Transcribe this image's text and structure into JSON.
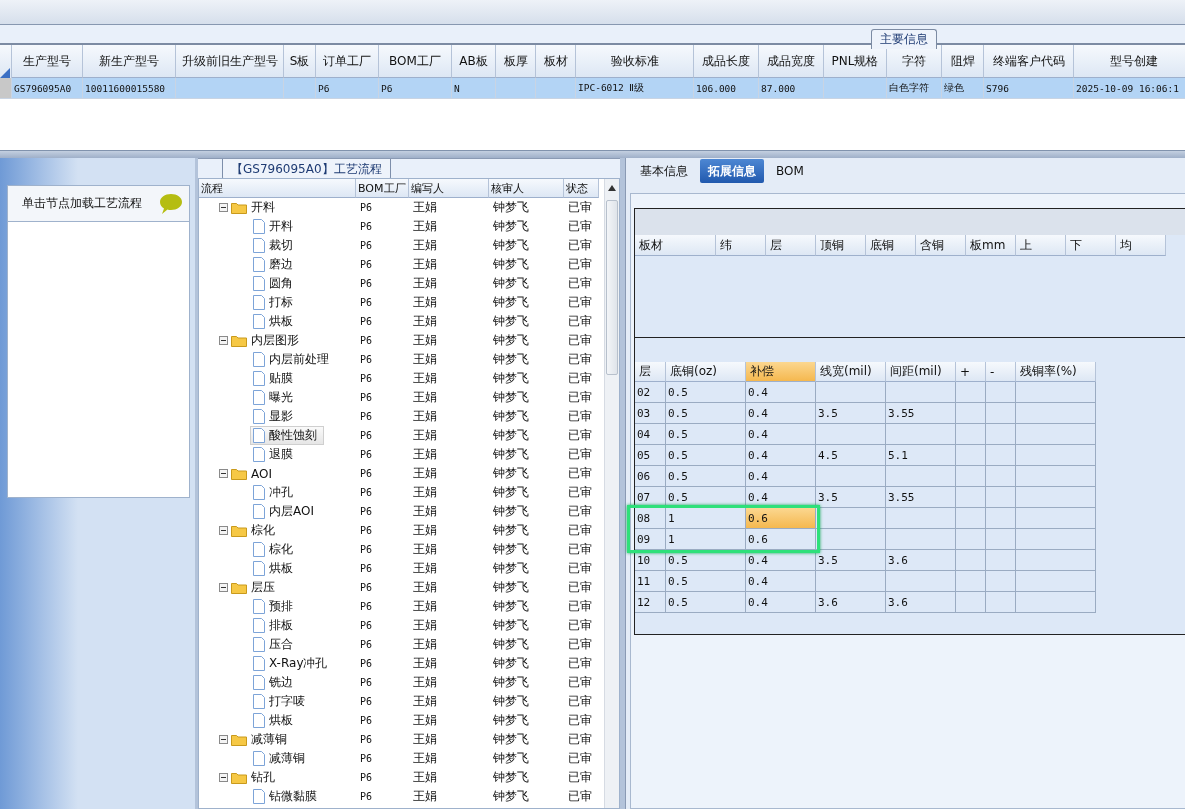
{
  "main_info": {
    "title": "主要信息",
    "columns": [
      "生产型号",
      "新生产型号",
      "升级前旧生产型号",
      "S板",
      "订单工厂",
      "BOM工厂",
      "AB板",
      "板厚",
      "板材",
      "验收标准",
      "成品长度",
      "成品宽度",
      "PNL规格",
      "字符",
      "阻焊",
      "终端客户代码",
      "型号创建"
    ],
    "rows": [
      {
        "selected": true,
        "cells": [
          "GS796095A0",
          "10011600015580",
          null,
          null,
          "P6",
          "P6",
          "N",
          null,
          null,
          "IPC-6012 Ⅱ级",
          "106.000",
          "87.000",
          null,
          "白色字符",
          "绿色",
          "S796",
          "2025-10-09 16:06:1"
        ]
      }
    ]
  },
  "left_panel": {
    "hint": "单击节点加载工艺流程"
  },
  "process_flow": {
    "title": "【GS796095A0】工艺流程",
    "columns": [
      "流程",
      "BOM工厂",
      "编写人",
      "核审人",
      "状态"
    ],
    "nodes": [
      {
        "label": "开料",
        "bom": "P6",
        "writer": "王娟",
        "reviewer": "钟梦飞",
        "status": "已审",
        "expanded": true,
        "selected": false,
        "children": [
          {
            "label": "开料",
            "bom": "P6",
            "writer": "王娟",
            "reviewer": "钟梦飞",
            "status": "已审",
            "selected": false
          },
          {
            "label": "裁切",
            "bom": "P6",
            "writer": "王娟",
            "reviewer": "钟梦飞",
            "status": "已审",
            "selected": false
          },
          {
            "label": "磨边",
            "bom": "P6",
            "writer": "王娟",
            "reviewer": "钟梦飞",
            "status": "已审",
            "selected": false
          },
          {
            "label": "圆角",
            "bom": "P6",
            "writer": "王娟",
            "reviewer": "钟梦飞",
            "status": "已审",
            "selected": false
          },
          {
            "label": "打标",
            "bom": "P6",
            "writer": "王娟",
            "reviewer": "钟梦飞",
            "status": "已审",
            "selected": false
          },
          {
            "label": "烘板",
            "bom": "P6",
            "writer": "王娟",
            "reviewer": "钟梦飞",
            "status": "已审",
            "selected": false
          }
        ]
      },
      {
        "label": "内层图形",
        "bom": "P6",
        "writer": "王娟",
        "reviewer": "钟梦飞",
        "status": "已审",
        "expanded": true,
        "selected": false,
        "children": [
          {
            "label": "内层前处理",
            "bom": "P6",
            "writer": "王娟",
            "reviewer": "钟梦飞",
            "status": "已审",
            "selected": false
          },
          {
            "label": "贴膜",
            "bom": "P6",
            "writer": "王娟",
            "reviewer": "钟梦飞",
            "status": "已审",
            "selected": false
          },
          {
            "label": "曝光",
            "bom": "P6",
            "writer": "王娟",
            "reviewer": "钟梦飞",
            "status": "已审",
            "selected": false
          },
          {
            "label": "显影",
            "bom": "P6",
            "writer": "王娟",
            "reviewer": "钟梦飞",
            "status": "已审",
            "selected": false
          },
          {
            "label": "酸性蚀刻",
            "bom": "P6",
            "writer": "王娟",
            "reviewer": "钟梦飞",
            "status": "已审",
            "selected": true
          },
          {
            "label": "退膜",
            "bom": "P6",
            "writer": "王娟",
            "reviewer": "钟梦飞",
            "status": "已审",
            "selected": false
          }
        ]
      },
      {
        "label": "AOI",
        "bom": "P6",
        "writer": "王娟",
        "reviewer": "钟梦飞",
        "status": "已审",
        "expanded": true,
        "selected": false,
        "children": [
          {
            "label": "冲孔",
            "bom": "P6",
            "writer": "王娟",
            "reviewer": "钟梦飞",
            "status": "已审",
            "selected": false
          },
          {
            "label": "内层AOI",
            "bom": "P6",
            "writer": "王娟",
            "reviewer": "钟梦飞",
            "status": "已审",
            "selected": false
          }
        ]
      },
      {
        "label": "棕化",
        "bom": "P6",
        "writer": "王娟",
        "reviewer": "钟梦飞",
        "status": "已审",
        "expanded": true,
        "selected": false,
        "children": [
          {
            "label": "棕化",
            "bom": "P6",
            "writer": "王娟",
            "reviewer": "钟梦飞",
            "status": "已审",
            "selected": false
          },
          {
            "label": "烘板",
            "bom": "P6",
            "writer": "王娟",
            "reviewer": "钟梦飞",
            "status": "已审",
            "selected": false
          }
        ]
      },
      {
        "label": "层压",
        "bom": "P6",
        "writer": "王娟",
        "reviewer": "钟梦飞",
        "status": "已审",
        "expanded": true,
        "selected": false,
        "children": [
          {
            "label": "预排",
            "bom": "P6",
            "writer": "王娟",
            "reviewer": "钟梦飞",
            "status": "已审",
            "selected": false
          },
          {
            "label": "排板",
            "bom": "P6",
            "writer": "王娟",
            "reviewer": "钟梦飞",
            "status": "已审",
            "selected": false
          },
          {
            "label": "压合",
            "bom": "P6",
            "writer": "王娟",
            "reviewer": "钟梦飞",
            "status": "已审",
            "selected": false
          },
          {
            "label": "X-Ray冲孔",
            "bom": "P6",
            "writer": "王娟",
            "reviewer": "钟梦飞",
            "status": "已审",
            "selected": false
          },
          {
            "label": "铣边",
            "bom": "P6",
            "writer": "王娟",
            "reviewer": "钟梦飞",
            "status": "已审",
            "selected": false
          },
          {
            "label": "打字唛",
            "bom": "P6",
            "writer": "王娟",
            "reviewer": "钟梦飞",
            "status": "已审",
            "selected": false
          },
          {
            "label": "烘板",
            "bom": "P6",
            "writer": "王娟",
            "reviewer": "钟梦飞",
            "status": "已审",
            "selected": false
          }
        ]
      },
      {
        "label": "减薄铜",
        "bom": "P6",
        "writer": "王娟",
        "reviewer": "钟梦飞",
        "status": "已审",
        "expanded": true,
        "selected": false,
        "children": [
          {
            "label": "减薄铜",
            "bom": "P6",
            "writer": "王娟",
            "reviewer": "钟梦飞",
            "status": "已审",
            "selected": false
          }
        ]
      },
      {
        "label": "钻孔",
        "bom": "P6",
        "writer": "王娟",
        "reviewer": "钟梦飞",
        "status": "已审",
        "expanded": true,
        "selected": false,
        "children": [
          {
            "label": "钻微黏膜",
            "bom": "P6",
            "writer": "王娟",
            "reviewer": "钟梦飞",
            "status": "已审",
            "selected": false
          }
        ]
      }
    ]
  },
  "tabs": [
    {
      "label": "基本信息",
      "selected": false
    },
    {
      "label": "拓展信息",
      "selected": true
    },
    {
      "label": "BOM",
      "selected": false
    }
  ],
  "material": {
    "columns": [
      "板材",
      "纬",
      "层",
      "顶铜",
      "底铜",
      "含铜",
      "板mm",
      "上",
      "下",
      "均"
    ]
  },
  "layers": {
    "columns": [
      {
        "label": "层",
        "selected": false
      },
      {
        "label": "底铜(oz)",
        "selected": false
      },
      {
        "label": "补偿",
        "selected": true
      },
      {
        "label": "线宽(mil)",
        "selected": false
      },
      {
        "label": "间距(mil)",
        "selected": false
      },
      {
        "label": "+",
        "selected": false
      },
      {
        "label": "-",
        "selected": false
      },
      {
        "label": "残铜率(%)",
        "selected": false
      }
    ],
    "rows": [
      {
        "cells": [
          "02",
          "0.5",
          "0.4",
          null,
          null,
          null,
          null,
          null
        ],
        "selected": false,
        "highlighted": false
      },
      {
        "cells": [
          "03",
          "0.5",
          "0.4",
          "3.5",
          "3.55",
          null,
          null,
          null
        ],
        "selected": false,
        "highlighted": false
      },
      {
        "cells": [
          "04",
          "0.5",
          "0.4",
          null,
          null,
          null,
          null,
          null
        ],
        "selected": false,
        "highlighted": false
      },
      {
        "cells": [
          "05",
          "0.5",
          "0.4",
          "4.5",
          "5.1",
          null,
          null,
          null
        ],
        "selected": false,
        "highlighted": false
      },
      {
        "cells": [
          "06",
          "0.5",
          "0.4",
          null,
          null,
          null,
          null,
          null
        ],
        "selected": false,
        "highlighted": false
      },
      {
        "cells": [
          "07",
          "0.5",
          "0.4",
          "3.5",
          "3.55",
          null,
          null,
          null
        ],
        "selected": false,
        "highlighted": false
      },
      {
        "cells": [
          "08",
          "1",
          "0.6",
          null,
          null,
          null,
          null,
          null
        ],
        "selected": true,
        "highlighted": true
      },
      {
        "cells": [
          "09",
          "1",
          "0.6",
          null,
          null,
          null,
          null,
          null
        ],
        "selected": false,
        "highlighted": true
      },
      {
        "cells": [
          "10",
          "0.5",
          "0.4",
          "3.5",
          "3.6",
          null,
          null,
          null
        ],
        "selected": false,
        "highlighted": false
      },
      {
        "cells": [
          "11",
          "0.5",
          "0.4",
          null,
          null,
          null,
          null,
          null
        ],
        "selected": false,
        "highlighted": false
      },
      {
        "cells": [
          "12",
          "0.5",
          "0.4",
          "3.6",
          "3.6",
          null,
          null,
          null
        ],
        "selected": false,
        "highlighted": false
      }
    ]
  }
}
